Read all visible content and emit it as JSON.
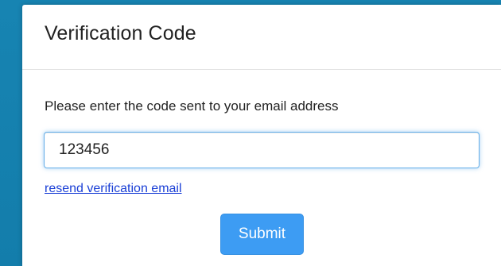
{
  "modal": {
    "title": "Verification Code",
    "prompt": "Please enter the code sent to your email address",
    "code_input": {
      "value": "123456",
      "placeholder": ""
    },
    "resend_link": "resend verification email",
    "submit_label": "Submit"
  },
  "colors": {
    "backdrop": "#1480ad",
    "link": "#1a3fd6",
    "submit_button": "#3d9cf3",
    "input_focus_border": "#66afe9"
  }
}
